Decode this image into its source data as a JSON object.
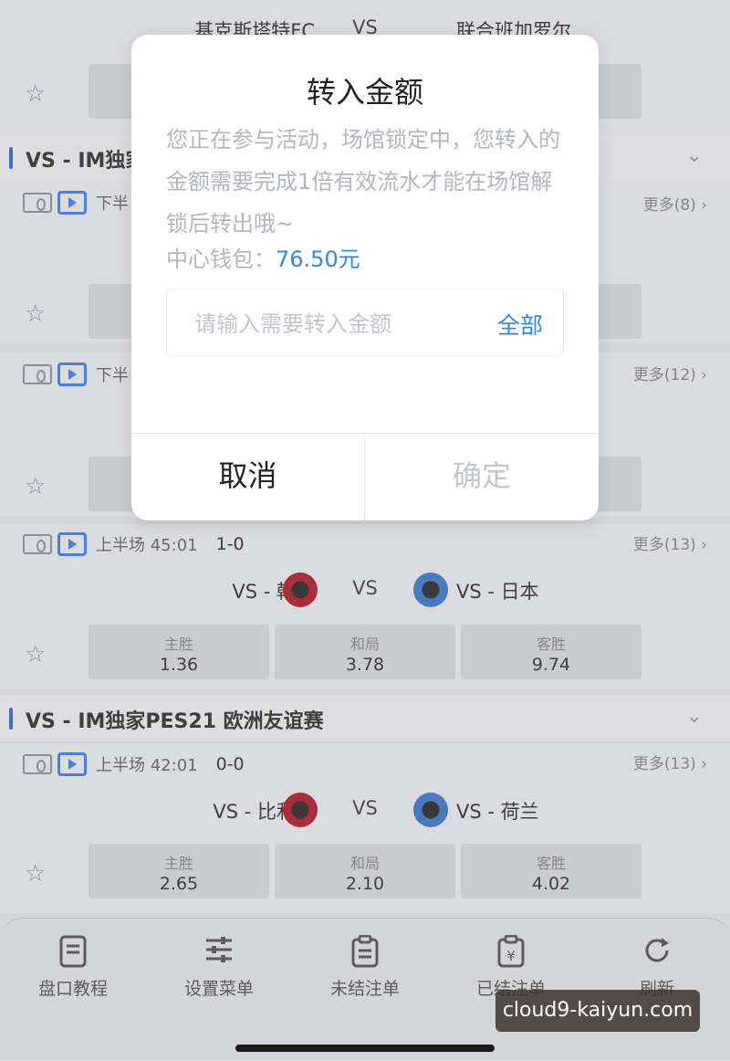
{
  "top_match": {
    "home_team": "基克斯塔特FC",
    "vs": "VS",
    "away_team": "联合班加罗尔"
  },
  "league1": {
    "title": "VS - IM独家"
  },
  "match_a": {
    "period": "下半",
    "more": "更多(8)"
  },
  "match_b": {
    "period": "下半",
    "more": "更多(12)"
  },
  "match_c": {
    "period": "上半场 45:01",
    "score": "1-0",
    "more": "更多(13)",
    "home": "VS - 韩国",
    "vs": "VS",
    "away": "VS - 日本",
    "odds": [
      {
        "label": "主胜",
        "value": "1.36"
      },
      {
        "label": "和局",
        "value": "3.78"
      },
      {
        "label": "客胜",
        "value": "9.74"
      }
    ]
  },
  "league2": {
    "title": "VS - IM独家PES21 欧洲友谊赛"
  },
  "match_d": {
    "period": "上半场 42:01",
    "score": "0-0",
    "more": "更多(13)",
    "home": "VS - 比利时",
    "vs": "VS",
    "away": "VS - 荷兰",
    "odds": [
      {
        "label": "主胜",
        "value": "2.65"
      },
      {
        "label": "和局",
        "value": "2.10"
      },
      {
        "label": "客胜",
        "value": "4.02"
      }
    ]
  },
  "tabbar": {
    "items": [
      {
        "label": "盘口教程",
        "icon": "document-icon"
      },
      {
        "label": "设置菜单",
        "icon": "sliders-icon"
      },
      {
        "label": "未结注单",
        "icon": "clipboard-icon"
      },
      {
        "label": "已结注单",
        "icon": "yen-clipboard-icon"
      },
      {
        "label": "刷新",
        "icon": "refresh-icon"
      }
    ]
  },
  "dialog": {
    "title": "转入金额",
    "message": "您正在参与活动，场馆锁定中，您转入的金额需要完成1倍有效流水才能在场馆解锁后转出哦~",
    "wallet_label": "中心钱包：",
    "wallet_amount": "76.50元",
    "input_placeholder": "请输入需要转入金额",
    "all_label": "全部",
    "cancel_label": "取消",
    "confirm_label": "确定"
  },
  "watermark": "cloud9-kaiyun.com",
  "colors": {
    "accent": "#2f8ad8",
    "league_bar": "#2f6fd6"
  }
}
